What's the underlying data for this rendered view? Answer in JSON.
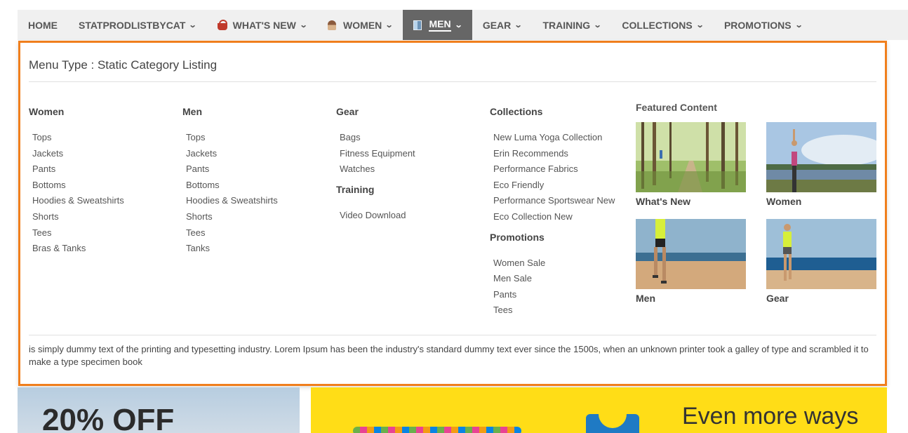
{
  "nav": {
    "items": [
      {
        "label": "HOME",
        "icon": null,
        "chevron": false
      },
      {
        "label": "STATPRODLISTBYCAT",
        "icon": null,
        "chevron": true
      },
      {
        "label": "WHAT'S NEW",
        "icon": "basket-icon",
        "chevron": true
      },
      {
        "label": "WOMEN",
        "icon": "woman-icon",
        "chevron": true
      },
      {
        "label": "MEN",
        "icon": "men-icon",
        "chevron": true,
        "active": true
      },
      {
        "label": "GEAR",
        "icon": null,
        "chevron": true
      },
      {
        "label": "TRAINING",
        "icon": null,
        "chevron": true
      },
      {
        "label": "COLLECTIONS",
        "icon": null,
        "chevron": true
      },
      {
        "label": "PROMOTIONS",
        "icon": null,
        "chevron": true
      }
    ]
  },
  "mega": {
    "menu_type": "Menu Type : Static Category Listing",
    "women": {
      "title": "Women",
      "items": [
        "Tops",
        "Jackets",
        "Pants",
        "Bottoms",
        "Hoodies & Sweatshirts",
        "Shorts",
        "Tees",
        "Bras & Tanks"
      ]
    },
    "men": {
      "title": "Men",
      "items": [
        "Tops",
        "Jackets",
        "Pants",
        "Bottoms",
        "Hoodies & Sweatshirts",
        "Shorts",
        "Tees",
        "Tanks"
      ]
    },
    "gear": {
      "title": "Gear",
      "items": [
        "Bags",
        "Fitness Equipment",
        "Watches"
      ]
    },
    "training": {
      "title": "Training",
      "items": [
        "Video Download"
      ]
    },
    "collections": {
      "title": "Collections",
      "items": [
        "New Luma Yoga Collection",
        "Erin Recommends",
        "Performance Fabrics",
        "Eco Friendly",
        "Performance Sportswear New",
        "Eco Collection New"
      ]
    },
    "promotions": {
      "title": "Promotions",
      "items": [
        "Women Sale",
        "Men Sale",
        "Pants",
        "Tees"
      ]
    },
    "featured": {
      "title": "Featured Content",
      "cards": [
        {
          "caption": "What's New",
          "image": "forest-trail-image"
        },
        {
          "caption": "Women",
          "image": "yoga-lake-image"
        },
        {
          "caption": "Men",
          "image": "beach-runner-image"
        },
        {
          "caption": "Gear",
          "image": "beach-woman-image"
        }
      ]
    },
    "description": "is simply dummy text of the printing and typesetting industry. Lorem Ipsum has been the industry's standard dummy text ever since the 1500s, when an unknown printer took a galley of type and scrambled it to make a type specimen book"
  },
  "banners": {
    "left_text": "20% OFF",
    "right_text": "Even more ways"
  },
  "colors": {
    "accent_border": "#f07f1d",
    "nav_active_bg": "#666666",
    "banner_yellow": "#ffdd17"
  }
}
